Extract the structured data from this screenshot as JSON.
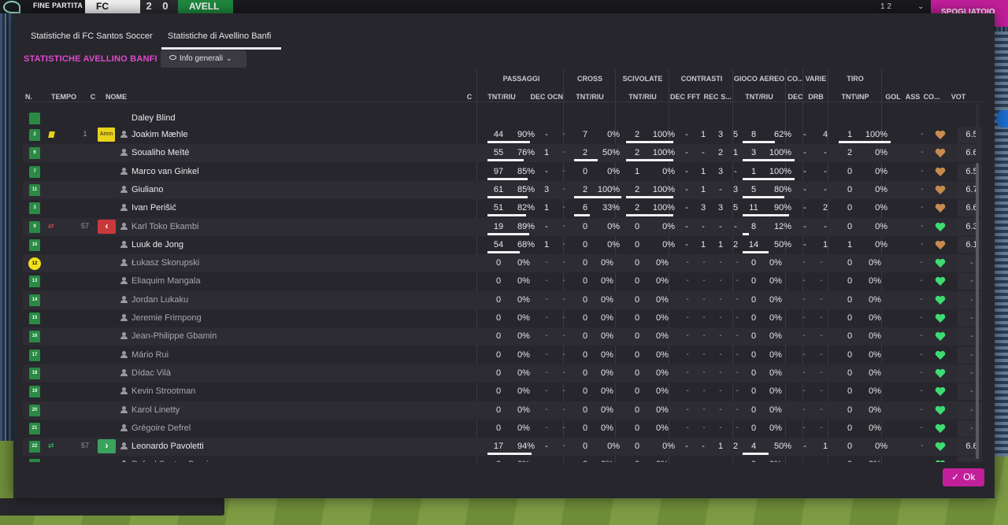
{
  "topbar": {
    "status": "FINE PARTITA",
    "team_home": "FC SAN",
    "score": "2 0",
    "team_away": "AVELL",
    "counter": "1 2",
    "chevron": "⌄",
    "right_button": "SPOGLIATOIO"
  },
  "tabs": [
    {
      "label": "Statistiche di FC Santos Soccer",
      "active": false
    },
    {
      "label": "Statistiche di Avellino Banfi",
      "active": true
    }
  ],
  "section_title": "STATISTICHE AVELLINO BANFI",
  "view_dropdown": {
    "label": "Info generali"
  },
  "groups": {
    "passaggi": "PASSAGGI",
    "cross": "CROSS",
    "scivolate": "SCIVOLATE",
    "contrasti": "CONTRASTI",
    "gioco_aereo": "GIOCO AEREO",
    "co": "CO...",
    "varie": "VARIE",
    "tiro": "TIRO"
  },
  "columns": {
    "n": "N.",
    "tempo": "TEMPO",
    "c": "C",
    "nome": "NOME",
    "c2": "C",
    "pass_tnt": "TNT/RIU",
    "pass_dec": "DEC",
    "pass_ocn": "OCN",
    "cross_tnt": "TNT/RIU",
    "sciv_tnt": "TNT/RIU",
    "con_dec": "DEC",
    "con_fft": "FFT",
    "con_rec": "REC",
    "con_s": "S...",
    "aer_tnt": "TNT/RIU",
    "co_dec": "DEC",
    "varie_drb": "DRB",
    "tiro_tnt": "TNT\\INP",
    "gol": "GOL",
    "ass": "ASS",
    "co2": "CO...",
    "vot": "VOT"
  },
  "partial_row": {
    "name": "Daley Blind"
  },
  "rows": [
    {
      "n": "2",
      "event": "yellow",
      "tempo": "1",
      "badge": "Amm",
      "name": "Joakim Mæhle",
      "active": true,
      "pass": [
        "44",
        "90%"
      ],
      "pass_dec": "-",
      "pass_ocn": "-",
      "cross": [
        "7",
        "0%"
      ],
      "sciv": [
        "2",
        "100%"
      ],
      "con_dec": "-",
      "con_fft": "1",
      "con_rec": "3",
      "con_s": "5",
      "aer": [
        "8",
        "62%"
      ],
      "co_dec": "-",
      "drb": "4",
      "tiro": [
        "1",
        "100%"
      ],
      "gol": "",
      "ass": "-",
      "cond": "brown",
      "vote": "6.5",
      "bars": [
        0.9,
        0,
        1.0,
        0.62,
        1.0
      ]
    },
    {
      "n": "6",
      "event": "",
      "tempo": "",
      "badge": "",
      "name": "Soualiho Meïté",
      "active": true,
      "pass": [
        "55",
        "76%"
      ],
      "pass_dec": "1",
      "pass_ocn": "-",
      "cross": [
        "2",
        "50%"
      ],
      "sciv": [
        "2",
        "100%"
      ],
      "con_dec": "-",
      "con_fft": "-",
      "con_rec": "2",
      "con_s": "1",
      "aer": [
        "3",
        "100%"
      ],
      "co_dec": "-",
      "drb": "-",
      "tiro": [
        "2",
        "0%"
      ],
      "gol": "",
      "ass": "-",
      "cond": "brown",
      "vote": "6.6",
      "bars": [
        0.76,
        0.5,
        1.0,
        1.0,
        0
      ]
    },
    {
      "n": "7",
      "event": "",
      "tempo": "",
      "badge": "",
      "name": "Marco van Ginkel",
      "active": true,
      "pass": [
        "97",
        "85%"
      ],
      "pass_dec": "-",
      "pass_ocn": "-",
      "cross": [
        "0",
        "0%"
      ],
      "sciv": [
        "1",
        "0%"
      ],
      "con_dec": "-",
      "con_fft": "1",
      "con_rec": "3",
      "con_s": "-",
      "aer": [
        "1",
        "100%"
      ],
      "co_dec": "-",
      "drb": "-",
      "tiro": [
        "0",
        "0%"
      ],
      "gol": "",
      "ass": "-",
      "cond": "brown",
      "vote": "6.5",
      "bars": [
        0.85,
        0,
        0,
        1.0,
        0
      ]
    },
    {
      "n": "11",
      "event": "",
      "tempo": "",
      "badge": "",
      "name": "Giuliano",
      "active": true,
      "pass": [
        "61",
        "85%"
      ],
      "pass_dec": "3",
      "pass_ocn": "-",
      "cross": [
        "2",
        "100%"
      ],
      "sciv": [
        "2",
        "100%"
      ],
      "con_dec": "-",
      "con_fft": "1",
      "con_rec": "-",
      "con_s": "3",
      "aer": [
        "5",
        "80%"
      ],
      "co_dec": "-",
      "drb": "-",
      "tiro": [
        "0",
        "0%"
      ],
      "gol": "",
      "ass": "-",
      "cond": "brown",
      "vote": "6.7",
      "bars": [
        0.85,
        1.0,
        1.0,
        0.8,
        0
      ]
    },
    {
      "n": "3",
      "event": "",
      "tempo": "",
      "badge": "",
      "name": "Ivan Perišić",
      "active": true,
      "pass": [
        "51",
        "82%"
      ],
      "pass_dec": "1",
      "pass_ocn": "-",
      "cross": [
        "6",
        "33%"
      ],
      "sciv": [
        "2",
        "100%"
      ],
      "con_dec": "-",
      "con_fft": "3",
      "con_rec": "3",
      "con_s": "5",
      "aer": [
        "11",
        "90%"
      ],
      "co_dec": "-",
      "drb": "2",
      "tiro": [
        "0",
        "0%"
      ],
      "gol": "",
      "ass": "-",
      "cond": "brown",
      "vote": "6.6",
      "bars": [
        0.82,
        0.33,
        1.0,
        0.9,
        0
      ]
    },
    {
      "n": "9",
      "event": "sub-out",
      "tempo": "57",
      "badge": "out",
      "name": "Karl Toko Ekambi",
      "active": false,
      "pass": [
        "19",
        "89%"
      ],
      "pass_dec": "-",
      "pass_ocn": "-",
      "cross": [
        "0",
        "0%"
      ],
      "sciv": [
        "0",
        "0%"
      ],
      "con_dec": "-",
      "con_fft": "-",
      "con_rec": "-",
      "con_s": "-",
      "aer": [
        "8",
        "12%"
      ],
      "co_dec": "-",
      "drb": "-",
      "tiro": [
        "0",
        "0%"
      ],
      "gol": "",
      "ass": "-",
      "cond": "green",
      "vote": "6.3",
      "bars": [
        0.89,
        0,
        0,
        0.12,
        0
      ]
    },
    {
      "n": "10",
      "event": "",
      "tempo": "",
      "badge": "",
      "name": "Luuk de Jong",
      "active": true,
      "pass": [
        "54",
        "68%"
      ],
      "pass_dec": "1",
      "pass_ocn": "-",
      "cross": [
        "0",
        "0%"
      ],
      "sciv": [
        "0",
        "0%"
      ],
      "con_dec": "-",
      "con_fft": "1",
      "con_rec": "1",
      "con_s": "2",
      "aer": [
        "14",
        "50%"
      ],
      "co_dec": "-",
      "drb": "1",
      "tiro": [
        "1",
        "0%"
      ],
      "gol": "",
      "ass": "-",
      "cond": "brown",
      "vote": "6.1",
      "bars": [
        0.68,
        0,
        0,
        0.5,
        0
      ]
    },
    {
      "n": "12",
      "event": "",
      "tempo": "",
      "badge": "",
      "name": "Łukasz Skorupski",
      "active": false,
      "gk": true,
      "bench": true,
      "cond": "green",
      "vote": "-"
    },
    {
      "n": "13",
      "event": "",
      "tempo": "",
      "badge": "",
      "name": "Eliaquim Mangala",
      "active": false,
      "bench": true,
      "cond": "green",
      "vote": "-"
    },
    {
      "n": "14",
      "event": "",
      "tempo": "",
      "badge": "",
      "name": "Jordan Lukaku",
      "active": false,
      "bench": true,
      "cond": "green",
      "vote": "-"
    },
    {
      "n": "15",
      "event": "",
      "tempo": "",
      "badge": "",
      "name": "Jeremie Frimpong",
      "active": false,
      "bench": true,
      "cond": "green",
      "vote": "-"
    },
    {
      "n": "16",
      "event": "",
      "tempo": "",
      "badge": "",
      "name": "Jean-Philippe Gbamin",
      "active": false,
      "bench": true,
      "cond": "green",
      "vote": "-"
    },
    {
      "n": "17",
      "event": "",
      "tempo": "",
      "badge": "",
      "name": "Mário Rui",
      "active": false,
      "bench": true,
      "cond": "green",
      "vote": "-"
    },
    {
      "n": "18",
      "event": "",
      "tempo": "",
      "badge": "",
      "name": "Dídac Vilà",
      "active": false,
      "bench": true,
      "cond": "green",
      "vote": "-"
    },
    {
      "n": "19",
      "event": "",
      "tempo": "",
      "badge": "",
      "name": "Kevin Strootman",
      "active": false,
      "bench": true,
      "cond": "green",
      "vote": "-"
    },
    {
      "n": "20",
      "event": "",
      "tempo": "",
      "badge": "",
      "name": "Karol Linetty",
      "active": false,
      "bench": true,
      "cond": "green",
      "vote": "-"
    },
    {
      "n": "21",
      "event": "",
      "tempo": "",
      "badge": "",
      "name": "Grégoire Defrel",
      "active": false,
      "bench": true,
      "cond": "green",
      "vote": "-"
    },
    {
      "n": "22",
      "event": "sub-in",
      "tempo": "57",
      "badge": "in",
      "name": "Leonardo Pavoletti",
      "active": true,
      "pass": [
        "17",
        "94%"
      ],
      "pass_dec": "-",
      "pass_ocn": "-",
      "cross": [
        "0",
        "0%"
      ],
      "sciv": [
        "0",
        "0%"
      ],
      "con_dec": "-",
      "con_fft": "-",
      "con_rec": "1",
      "con_s": "2",
      "aer": [
        "4",
        "50%"
      ],
      "co_dec": "-",
      "drb": "1",
      "tiro": [
        "0",
        "0%"
      ],
      "gol": "",
      "ass": "-",
      "cond": "green",
      "vote": "6.6",
      "bars": [
        0.94,
        0,
        0,
        0.5,
        0
      ]
    },
    {
      "n": "23",
      "event": "",
      "tempo": "",
      "badge": "",
      "name": "Rafael Santos Borré",
      "active": false,
      "bench": true,
      "cond": "green",
      "vote": "-"
    }
  ],
  "ok_button": "Ok",
  "colors": {
    "accent": "#c21f9b",
    "title": "#e04ad1",
    "team_green": "#2a8a45",
    "yellow": "#e9d21b",
    "cond_green": "#3ddc73",
    "cond_brown": "#c98a4f"
  }
}
